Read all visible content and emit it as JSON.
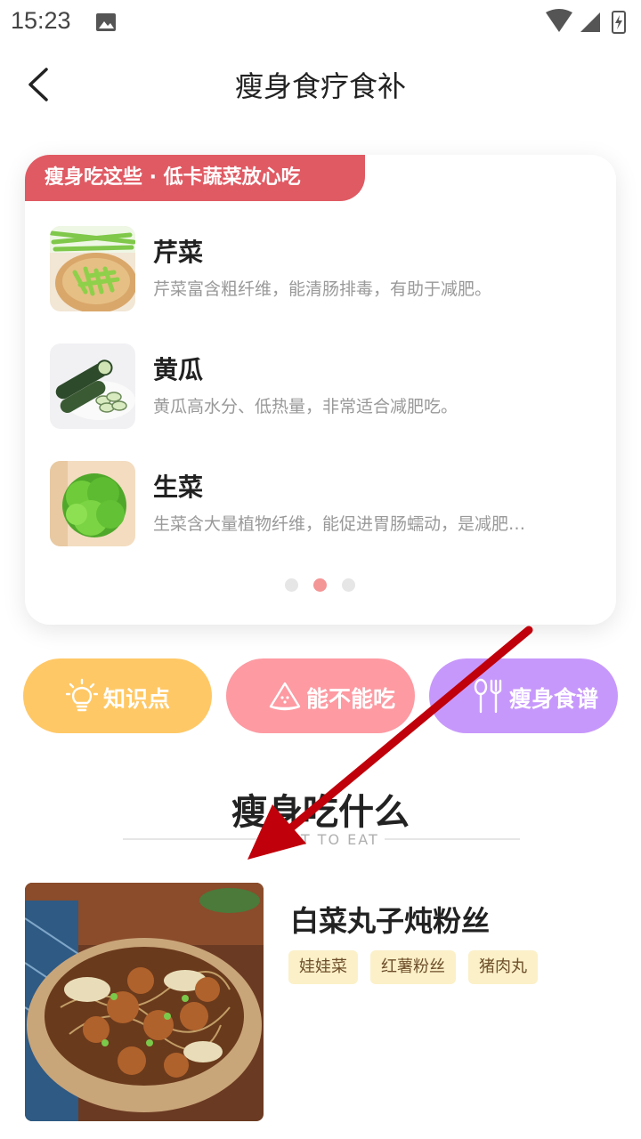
{
  "status_bar": {
    "time": "15:23"
  },
  "header": {
    "title": "瘦身食疗食补",
    "back_icon": "chevron-left-icon"
  },
  "card": {
    "banner": "瘦身吃这些 · 低卡蔬菜放心吃",
    "items": [
      {
        "name": "芹菜",
        "desc": "芹菜富含粗纤维，能清肠排毒，有助于减肥。"
      },
      {
        "name": "黄瓜",
        "desc": "黄瓜高水分、低热量，非常适合减肥吃。"
      },
      {
        "name": "生菜",
        "desc": "生菜含大量植物纤维，能促进胃肠蠕动，是减肥…"
      }
    ],
    "pager": {
      "count": 3,
      "active": 2
    }
  },
  "quick_actions": [
    {
      "label": "知识点",
      "icon": "lightbulb-icon",
      "color": "#ffc866"
    },
    {
      "label": "能不能吃",
      "icon": "watermelon-icon",
      "color": "#fd9aa2"
    },
    {
      "label": "瘦身食谱",
      "icon": "fork-spoon-icon",
      "color": "#c798fb"
    }
  ],
  "section": {
    "title": "瘦身吃什么",
    "subtitle": "WHAT TO EAT"
  },
  "recipe": {
    "title": "白菜丸子炖粉丝",
    "tags": [
      "娃娃菜",
      "红薯粉丝",
      "猪肉丸"
    ]
  },
  "colors": {
    "banner": "#e05a63",
    "accent_dot": "#f49596",
    "annotation_arrow": "#c0000a"
  }
}
